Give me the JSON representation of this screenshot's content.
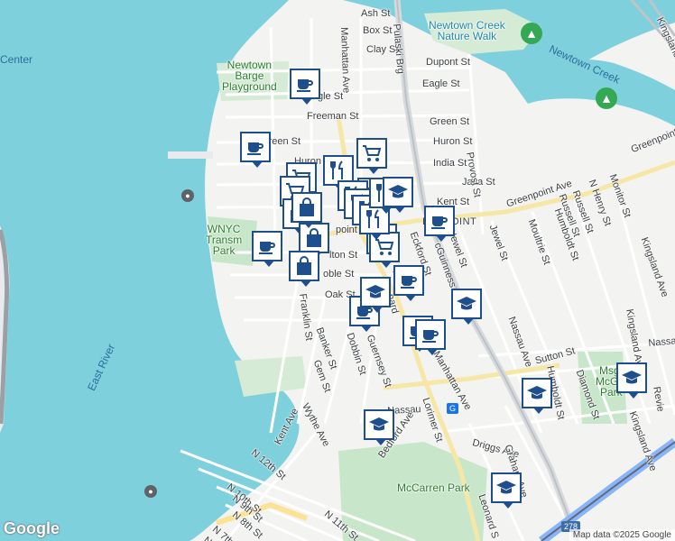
{
  "map": {
    "water_labels": [
      {
        "name": "label-center",
        "text": "Center"
      },
      {
        "name": "label-east-river",
        "text": "East River"
      },
      {
        "name": "label-newtown-creek",
        "text": "Newtown Creek"
      }
    ],
    "park_labels": [
      {
        "name": "label-newtown-barge-playground",
        "text": "Newtown\nBarge\nPlayground"
      },
      {
        "name": "label-newtown-creek-nature-walk",
        "text": "Newtown Creek\nNature Walk"
      },
      {
        "name": "label-wnyc-transmitter-park",
        "text": "WNYC\nTransm\nPark"
      },
      {
        "name": "label-mccarren-park",
        "text": "McCarren Park"
      },
      {
        "name": "label-msgr-mcgolrick-park",
        "text": "Msgr\nMcGol\nPark"
      }
    ],
    "neighborhood": "EENPOINT",
    "streets": [
      {
        "name": "street-ash-st",
        "text": "Ash St"
      },
      {
        "name": "street-box-st",
        "text": "Box St"
      },
      {
        "name": "street-clay-st",
        "text": "Clay St"
      },
      {
        "name": "street-dupont-st",
        "text": "Dupont St"
      },
      {
        "name": "street-eagle-st-east",
        "text": "Eagle St"
      },
      {
        "name": "street-eagle-st-west",
        "text": "gle St"
      },
      {
        "name": "street-freeman-st",
        "text": "Freeman St"
      },
      {
        "name": "street-green-st-east",
        "text": "Green St"
      },
      {
        "name": "street-green-st-west",
        "text": "Green St"
      },
      {
        "name": "street-huron-st-east",
        "text": "Huron St"
      },
      {
        "name": "street-huron-st-west",
        "text": "Huron St"
      },
      {
        "name": "street-india-st",
        "text": "India St"
      },
      {
        "name": "street-java-st",
        "text": "Java St"
      },
      {
        "name": "street-kent-st",
        "text": "Kent St"
      },
      {
        "name": "street-oak-st",
        "text": "Oak St"
      },
      {
        "name": "street-noble-st",
        "text": "oble St"
      },
      {
        "name": "street-milton-st",
        "text": "lton St"
      },
      {
        "name": "street-greenpoint-ave",
        "text": "Greenpoint Ave"
      },
      {
        "name": "street-greenpoint-ave-ne",
        "text": "Greenpoint"
      },
      {
        "name": "street-greenpoint-ave-west",
        "text": "point Ave"
      },
      {
        "name": "street-manhattan-ave-north",
        "text": "Manhattan Ave"
      },
      {
        "name": "street-manhattan-ave-south",
        "text": "Manhattan Ave"
      },
      {
        "name": "street-pulaski-brg",
        "text": "Pulaski Brg"
      },
      {
        "name": "street-provost-st",
        "text": "Provost St"
      },
      {
        "name": "street-eckford-st",
        "text": "Eckford St"
      },
      {
        "name": "street-mcguinness",
        "text": "cGuinness"
      },
      {
        "name": "street-newel-st",
        "text": "Newel St"
      },
      {
        "name": "street-jewel-st",
        "text": "Jewel St"
      },
      {
        "name": "street-moultrie-st",
        "text": "Moultrie St"
      },
      {
        "name": "street-humboldt-st-north",
        "text": "Humboldt St"
      },
      {
        "name": "street-humboldt-st-south",
        "text": "Humboldt St"
      },
      {
        "name": "street-russell-st-north",
        "text": "Russell St"
      },
      {
        "name": "street-russell-st-south",
        "text": "Russell St"
      },
      {
        "name": "street-n-henry-st",
        "text": "N Henry St"
      },
      {
        "name": "street-monitor-st",
        "text": "Monitor St"
      },
      {
        "name": "street-kingsland-ave-north",
        "text": "Kingsland Ave"
      },
      {
        "name": "street-kingsland-ave-mid",
        "text": "Kingsland Ave"
      },
      {
        "name": "street-kingsland-ave-south",
        "text": "Kingsland Ave"
      },
      {
        "name": "street-kingsland-edge",
        "text": "Kingsland"
      },
      {
        "name": "street-revie-edge",
        "text": "Revie"
      },
      {
        "name": "street-sutton-st",
        "text": "Sutton St"
      },
      {
        "name": "street-nassau-ave-east",
        "text": "Nassau Ave"
      },
      {
        "name": "street-nassau-ave-edge",
        "text": "Nassau"
      },
      {
        "name": "street-nassau-ave-south",
        "text": "Nassau Ave"
      },
      {
        "name": "street-diamond-st",
        "text": "Diamond St"
      },
      {
        "name": "street-franklin-st",
        "text": "Franklin St"
      },
      {
        "name": "street-banker-st",
        "text": "Banker St"
      },
      {
        "name": "street-dobbin-st",
        "text": "Dobbin St"
      },
      {
        "name": "street-guernsey-st",
        "text": "Guernsey St"
      },
      {
        "name": "street-gem-st",
        "text": "Gem St"
      },
      {
        "name": "street-wythe-ave",
        "text": "Wythe Ave"
      },
      {
        "name": "street-kent-ave",
        "text": "Kent Ave"
      },
      {
        "name": "street-bedford-ave",
        "text": "Bedford Ave"
      },
      {
        "name": "street-lorimer-st",
        "text": "Lorimer St"
      },
      {
        "name": "street-driggs-ave",
        "text": "Driggs Ave"
      },
      {
        "name": "street-graham-ave",
        "text": "Graham Ave"
      },
      {
        "name": "street-leonard-st",
        "text": "Leonard S"
      },
      {
        "name": "street-n-12th-st",
        "text": "N 12th St"
      },
      {
        "name": "street-n-11th-st",
        "text": "N 11th St"
      },
      {
        "name": "street-n-10th-st",
        "text": "N 10th St"
      },
      {
        "name": "street-n-9th-st",
        "text": "N 9th St"
      },
      {
        "name": "street-n-8th-st",
        "text": "N 8th St"
      },
      {
        "name": "street-n-7th-st",
        "text": "N 7th St"
      },
      {
        "name": "street-n-6th-st",
        "text": "N 6th St"
      },
      {
        "name": "street-ave-fragment",
        "text": "Ave"
      },
      {
        "name": "street-nard-fragment",
        "text": "nard"
      },
      {
        "name": "street-st-fragment",
        "text": "St"
      }
    ],
    "markers": [
      {
        "name": "cafe-marker",
        "icon": "coffee-cup-icon"
      },
      {
        "name": "cafe-marker",
        "icon": "coffee-cup-icon"
      },
      {
        "name": "cafe-marker",
        "icon": "coffee-cup-icon"
      },
      {
        "name": "cafe-marker",
        "icon": "coffee-cup-icon"
      },
      {
        "name": "cafe-marker",
        "icon": "coffee-cup-icon"
      },
      {
        "name": "cafe-marker",
        "icon": "coffee-cup-icon"
      },
      {
        "name": "cafe-marker",
        "icon": "coffee-cup-icon"
      },
      {
        "name": "cafe-marker",
        "icon": "coffee-cup-icon"
      },
      {
        "name": "grocery-marker",
        "icon": "shopping-cart-icon"
      },
      {
        "name": "grocery-marker",
        "icon": "shopping-cart-icon"
      },
      {
        "name": "grocery-marker",
        "icon": "shopping-cart-icon"
      },
      {
        "name": "grocery-marker",
        "icon": "shopping-cart-icon"
      },
      {
        "name": "grocery-marker",
        "icon": "shopping-cart-icon"
      },
      {
        "name": "grocery-marker",
        "icon": "shopping-cart-icon"
      },
      {
        "name": "restaurant-marker",
        "icon": "fork-knife-icon"
      },
      {
        "name": "restaurant-marker",
        "icon": "fork-knife-icon"
      },
      {
        "name": "restaurant-marker",
        "icon": "fork-knife-icon"
      },
      {
        "name": "restaurant-marker",
        "icon": "fork-knife-icon"
      },
      {
        "name": "restaurant-marker",
        "icon": "fork-knife-icon"
      },
      {
        "name": "restaurant-marker",
        "icon": "fork-knife-icon"
      },
      {
        "name": "shop-marker",
        "icon": "shopping-bag-icon"
      },
      {
        "name": "shop-marker",
        "icon": "shopping-bag-icon"
      },
      {
        "name": "shop-marker",
        "icon": "shopping-bag-icon"
      },
      {
        "name": "shop-marker",
        "icon": "shopping-bag-icon"
      },
      {
        "name": "school-marker",
        "icon": "graduation-cap-icon"
      },
      {
        "name": "school-marker",
        "icon": "graduation-cap-icon"
      },
      {
        "name": "school-marker",
        "icon": "graduation-cap-icon"
      },
      {
        "name": "school-marker",
        "icon": "graduation-cap-icon"
      },
      {
        "name": "school-marker",
        "icon": "graduation-cap-icon"
      },
      {
        "name": "school-marker",
        "icon": "graduation-cap-icon"
      },
      {
        "name": "school-marker",
        "icon": "graduation-cap-icon"
      }
    ],
    "highway_shield": "278",
    "subway_badge": "G",
    "logo": "Google",
    "attribution": "Map data ©2025 Google",
    "colors": {
      "water": "#7fd0dd",
      "land": "#f3f3f1",
      "park": "#c8e6c9",
      "marker_border": "#1f4e8c",
      "highlight_road": "#f6e7a6"
    }
  }
}
